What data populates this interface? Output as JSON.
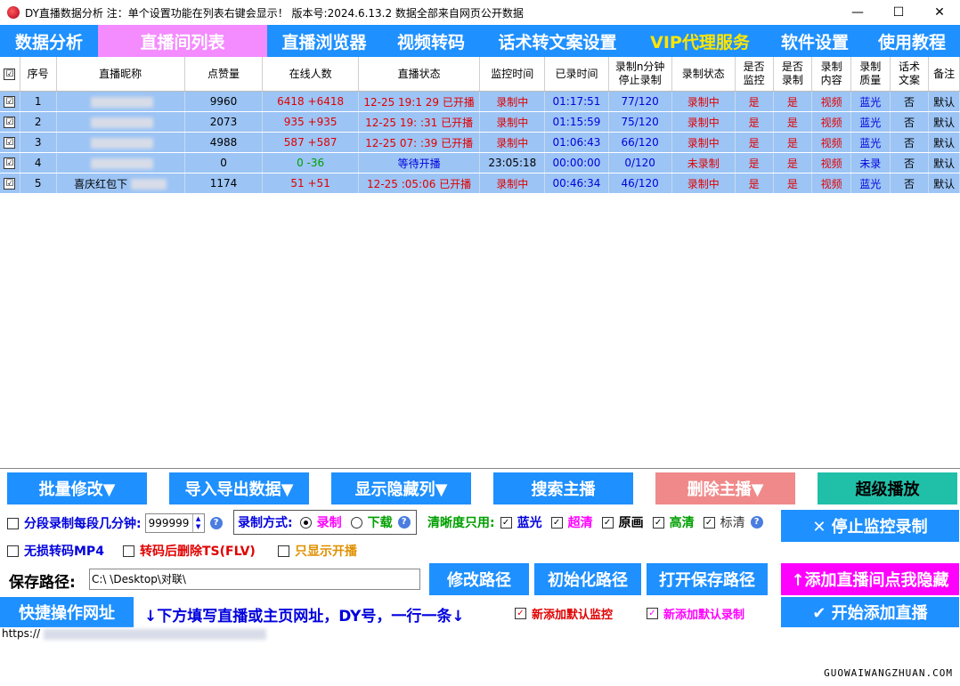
{
  "window": {
    "title": "DY直播数据分析   注：单个设置功能在列表右键会显示！   版本号:2024.6.13.2   数据全部来自网页公开数据",
    "minimize": "—",
    "maximize": "☐",
    "close": "✕"
  },
  "menu": [
    {
      "label": "数据分析"
    },
    {
      "label": "直播间列表"
    },
    {
      "label": "直播浏览器"
    },
    {
      "label": "视频转码"
    },
    {
      "label": "话术转文案设置"
    },
    {
      "label": "VIP代理服务"
    },
    {
      "label": "软件设置"
    },
    {
      "label": "使用教程"
    }
  ],
  "table": {
    "headers": {
      "check": "☑",
      "idx": "序号",
      "name": "直播昵称",
      "likes": "点赞量",
      "online": "在线人数",
      "status": "直播状态",
      "monitor_time": "监控时间",
      "recorded_time": "已录时间",
      "stop_after_a": "录制n分钟",
      "stop_after_b": "停止录制",
      "rec_state": "录制状态",
      "is_monitor_a": "是否",
      "is_monitor_b": "监控",
      "is_record_a": "是否",
      "is_record_b": "录制",
      "content_a": "录制",
      "content_b": "内容",
      "quality_a": "录制",
      "quality_b": "质量",
      "script_a": "话术",
      "script_b": "文案",
      "note": "备注"
    },
    "rows": [
      {
        "check": "☑",
        "idx": "1",
        "name": "",
        "likes": "9960",
        "online": "6418 +6418",
        "status": "12-25 19:1  29 已开播",
        "monitor_time": "录制中",
        "recorded_time": "01:17:51",
        "stop_after": "77/120",
        "rec_state": "录制中",
        "is_monitor": "是",
        "is_record": "是",
        "content": "视频",
        "quality": "蓝光",
        "script": "否",
        "note": "默认"
      },
      {
        "check": "☑",
        "idx": "2",
        "name": "",
        "likes": "2073",
        "online": "935 +935",
        "status": "12-25 19:   :31 已开播",
        "monitor_time": "录制中",
        "recorded_time": "01:15:59",
        "stop_after": "75/120",
        "rec_state": "录制中",
        "is_monitor": "是",
        "is_record": "是",
        "content": "视频",
        "quality": "蓝光",
        "script": "否",
        "note": "默认"
      },
      {
        "check": "☑",
        "idx": "3",
        "name": "",
        "likes": "4988",
        "online": "587 +587",
        "status": "12-25 07:  :39 已开播",
        "monitor_time": "录制中",
        "recorded_time": "01:06:43",
        "stop_after": "66/120",
        "rec_state": "录制中",
        "is_monitor": "是",
        "is_record": "是",
        "content": "视频",
        "quality": "蓝光",
        "script": "否",
        "note": "默认"
      },
      {
        "check": "☑",
        "idx": "4",
        "name": "",
        "likes": "0",
        "online": "0 -36",
        "status": "等待开播",
        "monitor_time": "23:05:18",
        "recorded_time": "00:00:00",
        "stop_after": "0/120",
        "rec_state": "未录制",
        "is_monitor": "是",
        "is_record": "是",
        "content": "视频",
        "quality": "未录",
        "script": "否",
        "note": "默认"
      },
      {
        "check": "☑",
        "idx": "5",
        "name": "喜庆红包下",
        "likes": "1174",
        "online": "51 +51",
        "status": "12-25   :05:06 已开播",
        "monitor_time": "录制中",
        "recorded_time": "00:46:34",
        "stop_after": "46/120",
        "rec_state": "录制中",
        "is_monitor": "是",
        "is_record": "是",
        "content": "视频",
        "quality": "蓝光",
        "script": "否",
        "note": "默认"
      }
    ]
  },
  "toolbar": {
    "batch": "批量修改▼",
    "import_export": "导入导出数据▼",
    "show_hidden": "显示隐藏列▼",
    "search": "搜索主播",
    "delete": "删除主播▼",
    "super_play": "超级播放"
  },
  "options": {
    "segment_label": "分段录制每段几分钟:",
    "segment_value": "999999",
    "help": "?",
    "record_mode": "录制方式:",
    "mode_record": "录制",
    "mode_download": "下载",
    "quality_only": "清晰度只用:",
    "q_bluray": "蓝光",
    "q_super": "超清",
    "q_original": "原画",
    "q_high": "高清",
    "q_standard": "标清",
    "stop_monitor": "✕ 停止监控录制",
    "lossless": "无损转码MP4",
    "delete_ts": "转码后删除TS(FLV)",
    "only_live": "只显示开播"
  },
  "path": {
    "label": "保存路径:",
    "value": "C:\\                \\Desktop\\对联\\",
    "modify": "修改路径",
    "init": "初始化路径",
    "open": "打开保存路径",
    "add_hide": "↑添加直播间点我隐藏"
  },
  "quick": {
    "label": "快捷操作网址",
    "hint": "↓下方填写直播或主页网址，DY号，一行一条↓",
    "default_monitor": "新添加默认监控",
    "default_record": "新添加默认录制",
    "start_add": "✔ 开始添加直播"
  },
  "url_input": {
    "value": "https://"
  },
  "watermark": "GUOWAIWANGZHUAN.COM",
  "colors": {
    "menu_bg": "#1e90ff",
    "menu_active": "#f48bff",
    "row_bg": "#9cc4f5",
    "status_red": "#e00000",
    "add_btn": "#ff00ff"
  }
}
